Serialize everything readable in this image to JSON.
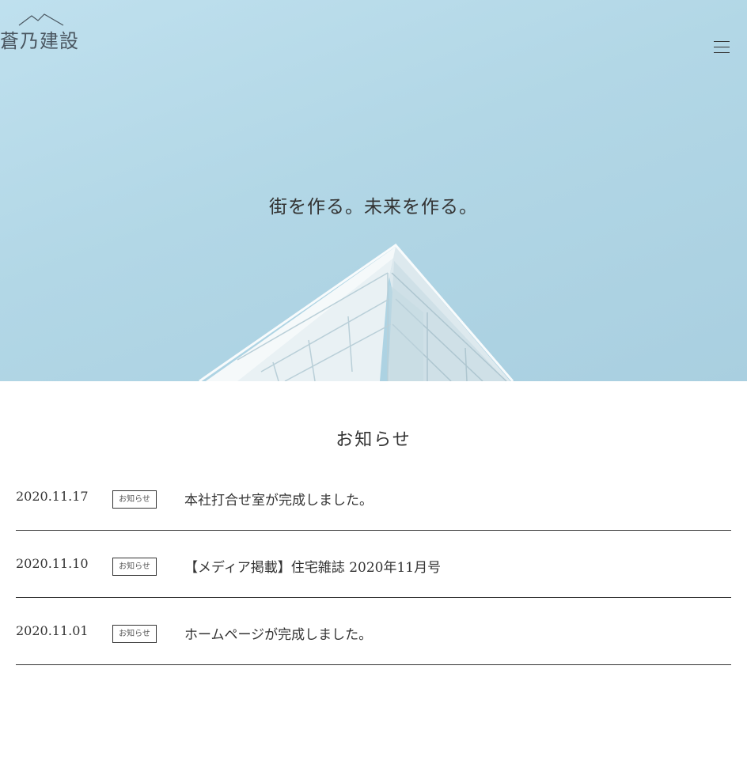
{
  "header": {
    "logo_text": "蒼乃建設",
    "menu_icon": "hamburger-icon"
  },
  "hero": {
    "tagline": "街を作る。未来を作る。"
  },
  "news": {
    "title": "お知らせ",
    "items": [
      {
        "date": "2020.11.17",
        "badge": "お知らせ",
        "text": "本社打合せ室が完成しました。"
      },
      {
        "date": "2020.11.10",
        "badge": "お知らせ",
        "text": "【メディア掲載】住宅雑誌 2020年11月号"
      },
      {
        "date": "2020.11.01",
        "badge": "お知らせ",
        "text": "ホームページが完成しました。"
      }
    ]
  }
}
